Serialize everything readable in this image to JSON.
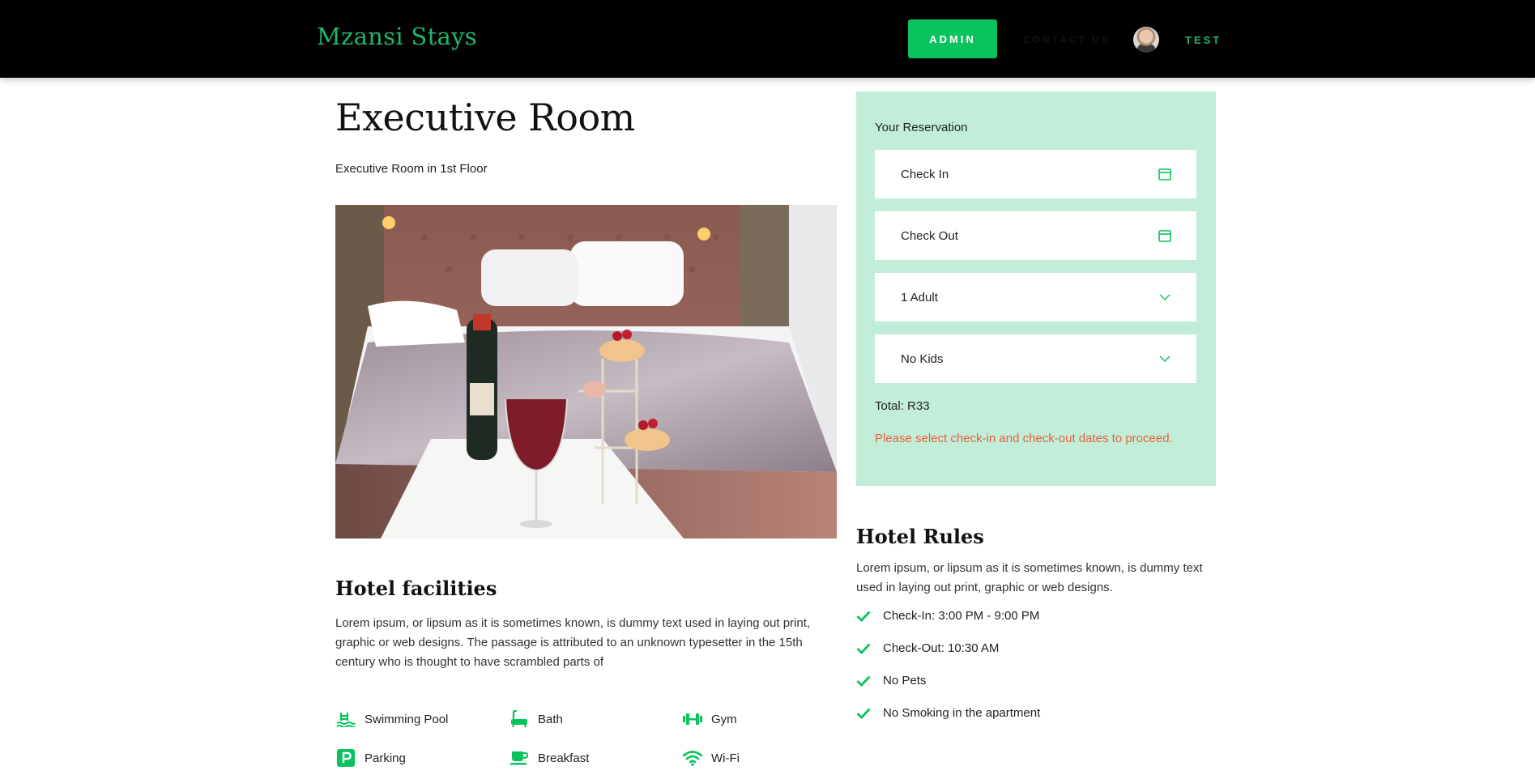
{
  "header": {
    "brand": "Mzansi Stays",
    "admin_label": "ADMIN",
    "contact_label": "CONTACT US",
    "user_label": "TEST"
  },
  "room": {
    "title": "Executive Room",
    "subtitle": "Executive Room in 1st Floor"
  },
  "facilities": {
    "title": "Hotel facilities",
    "text": "Lorem ipsum, or lipsum as it is sometimes known, is dummy text used in laying out print, graphic or web designs. The passage is attributed to an unknown typesetter in the 15th century who is thought to have scrambled parts of",
    "items": [
      {
        "label": "Swimming Pool",
        "icon": "pool-icon"
      },
      {
        "label": "Bath",
        "icon": "bath-icon"
      },
      {
        "label": "Gym",
        "icon": "gym-icon"
      },
      {
        "label": "Parking",
        "icon": "parking-icon"
      },
      {
        "label": "Breakfast",
        "icon": "coffee-icon"
      },
      {
        "label": "Wi-Fi",
        "icon": "wifi-icon"
      }
    ]
  },
  "reservation": {
    "title": "Your Reservation",
    "check_in": "Check In",
    "check_out": "Check Out",
    "adults": "1 Adult",
    "kids": "No Kids",
    "total": "Total: R33",
    "error": "Please select check-in and check-out dates to proceed."
  },
  "rules": {
    "title": "Hotel Rules",
    "text": "Lorem ipsum, or lipsum as it is sometimes known, is dummy text used in laying out print, graphic or web designs.",
    "items": [
      "Check-In: 3:00 PM - 9:00 PM",
      "Check-Out: 10:30 AM",
      "No Pets",
      "No Smoking in the apartment"
    ]
  },
  "colors": {
    "accent": "#0ac35f",
    "header_bg": "#000000",
    "reservation_bg": "#c2eed9",
    "error": "#e65f3e"
  }
}
